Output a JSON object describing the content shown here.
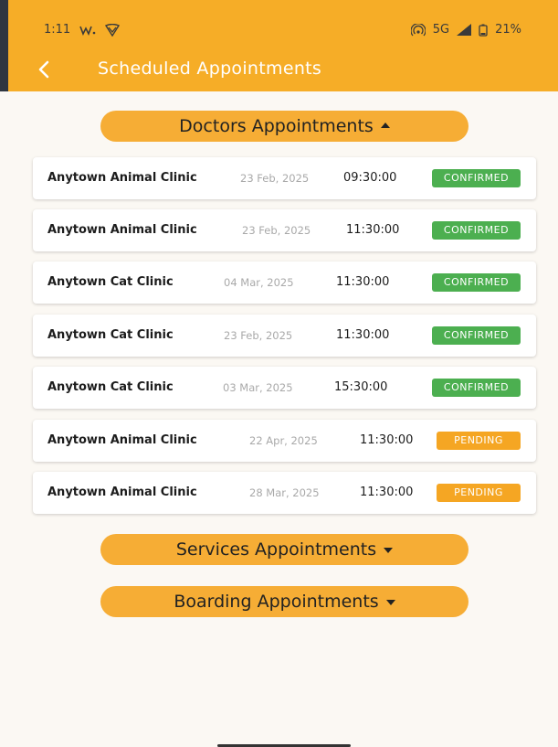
{
  "status": {
    "time": "1:11",
    "network": "5G",
    "battery": "21%"
  },
  "appbar": {
    "title": "Scheduled Appointments"
  },
  "sections": {
    "doctors": "Doctors Appointments",
    "services": "Services Appointments",
    "boarding": "Boarding Appointments"
  },
  "appointments": [
    {
      "clinic": "Anytown Animal Clinic",
      "date": "23 Feb, 2025",
      "time": "09:30:00",
      "status": "CONFIRMED"
    },
    {
      "clinic": "Anytown Animal Clinic",
      "date": "23 Feb, 2025",
      "time": "11:30:00",
      "status": "CONFIRMED"
    },
    {
      "clinic": "Anytown Cat Clinic",
      "date": "04 Mar, 2025",
      "time": "11:30:00",
      "status": "CONFIRMED"
    },
    {
      "clinic": "Anytown Cat Clinic",
      "date": "23 Feb, 2025",
      "time": "11:30:00",
      "status": "CONFIRMED"
    },
    {
      "clinic": "Anytown Cat Clinic",
      "date": "03 Mar, 2025",
      "time": "15:30:00",
      "status": "CONFIRMED"
    },
    {
      "clinic": "Anytown Animal Clinic",
      "date": "22 Apr, 2025",
      "time": "11:30:00",
      "status": "PENDING"
    },
    {
      "clinic": "Anytown Animal Clinic",
      "date": "28 Mar, 2025",
      "time": "11:30:00",
      "status": "PENDING"
    }
  ],
  "colors": {
    "header": "#f6ad27",
    "section_button": "#f6ad35",
    "confirmed": "#4caf50",
    "pending": "#f5a623",
    "background": "#fbf8f3"
  },
  "icons": {
    "back": "back-arrow-icon",
    "wifi_calling": "wifi-calling-icon",
    "vpn": "vpn-icon",
    "hotspot": "hotspot-icon",
    "signal": "signal-icon",
    "battery": "battery-icon"
  }
}
